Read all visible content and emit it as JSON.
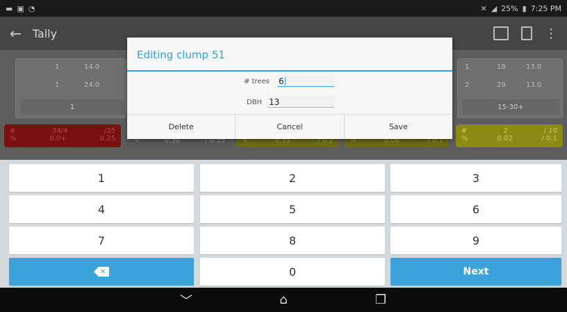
{
  "status_bar": {
    "left_icons": [
      "minus-icon",
      "image-icon",
      "wifi-icon"
    ],
    "right_text": "25%",
    "time": "7:25 PM"
  },
  "app_bar": {
    "title": "Tally"
  },
  "background_panels": {
    "left_panel": {
      "rows": [
        [
          "1",
          "14.0"
        ],
        [
          "1",
          "24.0"
        ]
      ],
      "footer": "1"
    },
    "right_panel": {
      "rows": [
        [
          "1",
          "18",
          "13.0"
        ],
        [
          "2",
          "29",
          "13.0"
        ]
      ],
      "footer": "15-30+"
    },
    "strips": [
      {
        "line1": [
          "#",
          "34/4",
          "/35"
        ],
        "line2": [
          "%",
          "0.0+",
          "0.25"
        ]
      },
      {
        "line1": [
          "",
          "",
          ""
        ],
        "line2": [
          "",
          "0.36",
          "/ 0.35"
        ]
      },
      {
        "line1": [
          "",
          "",
          ""
        ],
        "line2": [
          "",
          "0.15",
          "/ 0.2"
        ]
      },
      {
        "line1": [
          "",
          "",
          ""
        ],
        "line2": [
          "",
          "0.06",
          "/ 0.1"
        ]
      },
      {
        "line1": [
          "#",
          "2",
          "/ 10"
        ],
        "line2": [
          "%",
          "0.02",
          "/ 0.1"
        ]
      }
    ]
  },
  "dialog": {
    "title": "Editing clump 51",
    "trees_label": "# trees",
    "trees_value": "6",
    "dbh_label": "DBH",
    "dbh_value": "13",
    "buttons": {
      "delete": "Delete",
      "cancel": "Cancel",
      "save": "Save"
    }
  },
  "keypad": {
    "keys": [
      "1",
      "2",
      "3",
      "4",
      "5",
      "6",
      "7",
      "8",
      "9",
      "0"
    ],
    "delete_icon": "backspace-icon",
    "next": "Next"
  },
  "nav_bar": {
    "icons": [
      "back-chevron-icon",
      "home-icon",
      "recents-icon"
    ]
  },
  "colors": {
    "accent": "#33a1d6",
    "key_blue": "#3ba3d9",
    "danger_strip": "#7a1111",
    "warning_strip": "#8b8b12"
  }
}
